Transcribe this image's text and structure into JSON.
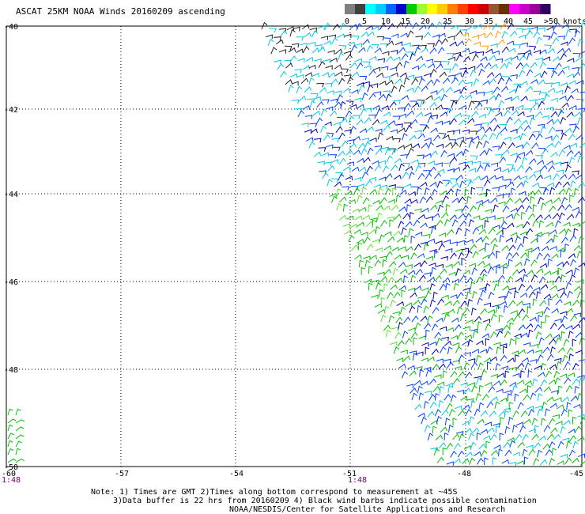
{
  "title": "ASCAT 25KM NOAA Winds 20160209 ascending",
  "legend": {
    "colors": [
      "#808080",
      "#404040",
      "#00ffff",
      "#00ccff",
      "#0066ff",
      "#0000cc",
      "#00cc00",
      "#99ff33",
      "#ffff00",
      "#ffcc00",
      "#ff8000",
      "#ff4000",
      "#ff0000",
      "#cc0000",
      "#995533",
      "#663300",
      "#ff00ff",
      "#cc00cc",
      "#990099",
      "#330066"
    ],
    "labels": [
      "0",
      "5",
      "10",
      "15",
      "20",
      "25",
      "30",
      "35",
      "40",
      "45",
      ">50 knots"
    ]
  },
  "axes": {
    "lat_labels": [
      "-40",
      "-42",
      "-44",
      "-46",
      "-48",
      "-50"
    ],
    "lon_labels": [
      "-60",
      "-57",
      "-54",
      "-51",
      "-48",
      "-45"
    ]
  },
  "time_labels": [
    "1:48",
    "1:48"
  ],
  "notes": [
    "Note: 1) Times are GMT 2)Times along bottom correspond to measurement at ~45S",
    "3)Data buffer is 22 hrs from 20160209 4) Black wind barbs indicate possible contamination",
    "NOAA/NESDIS/Center for Satellite Applications and Research"
  ]
}
